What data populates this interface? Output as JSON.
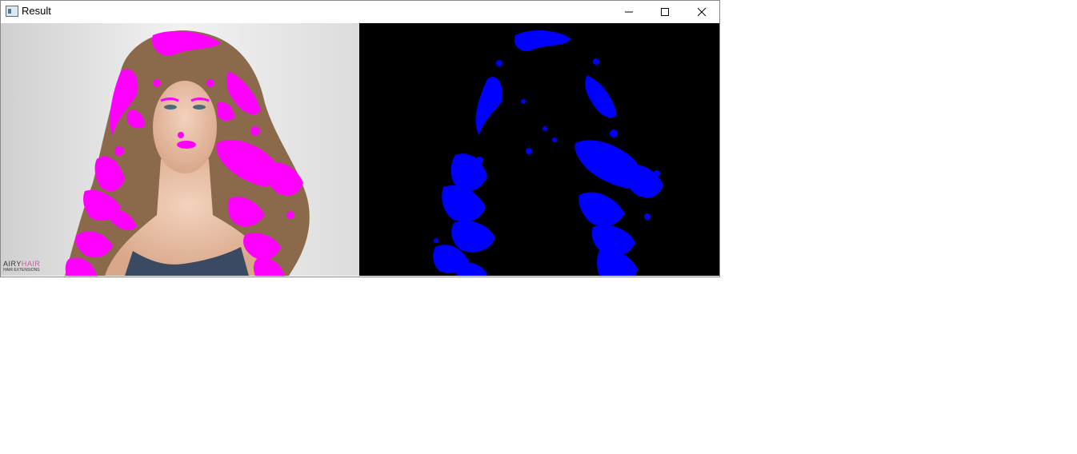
{
  "window": {
    "title": "Result",
    "controls": [
      "minimize-icon",
      "maximize-icon",
      "close-icon"
    ]
  },
  "left_pane": {
    "description_colors": {
      "hair": "#8a6a4a",
      "overlay": "#ff00ff",
      "background": "#e6e6e6"
    },
    "watermark": {
      "brand_part1": "AIRY",
      "brand_part2": "HAIR",
      "subtitle": "HAIR EXTENSIONS"
    }
  },
  "right_pane": {
    "colors": {
      "background": "#000000",
      "mask": "#0000ff"
    }
  }
}
